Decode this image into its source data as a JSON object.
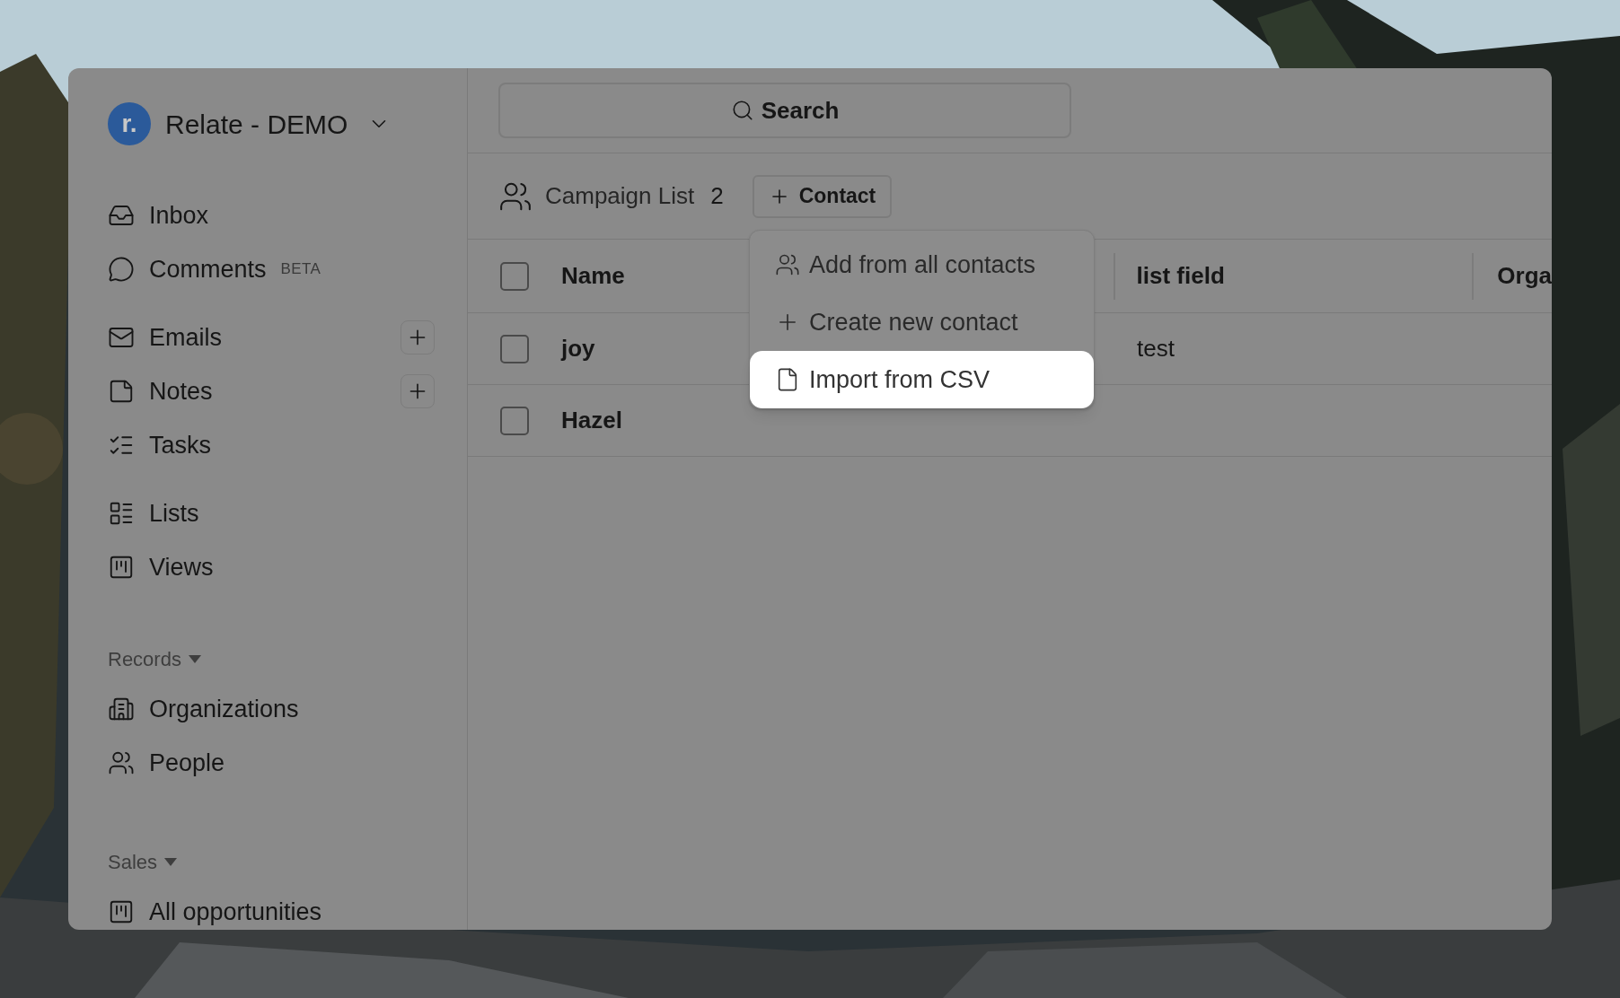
{
  "workspace": {
    "avatar": "r.",
    "name": "Relate - DEMO"
  },
  "sidebar": {
    "sections": [
      {
        "items": [
          {
            "label": "Inbox"
          },
          {
            "label": "Comments",
            "badge": "BETA"
          }
        ]
      },
      {
        "items": [
          {
            "label": "Emails",
            "add": true
          },
          {
            "label": "Notes",
            "add": true
          },
          {
            "label": "Tasks"
          }
        ]
      },
      {
        "items": [
          {
            "label": "Lists"
          },
          {
            "label": "Views"
          }
        ]
      },
      {
        "heading": "Records",
        "items": [
          {
            "label": "Organizations"
          },
          {
            "label": "People"
          }
        ]
      },
      {
        "heading": "Sales",
        "items": [
          {
            "label": "All opportunities"
          }
        ]
      }
    ]
  },
  "search": {
    "label": "Search"
  },
  "list_header": {
    "title": "Campaign List",
    "count": "2",
    "add_button": "Contact"
  },
  "menu": {
    "items": [
      {
        "label": "Add from all contacts",
        "selected": false
      },
      {
        "label": "Create new contact",
        "selected": false
      },
      {
        "label": "Import from CSV",
        "selected": true
      }
    ]
  },
  "table": {
    "header_checked": false,
    "columns": [
      "Name",
      "list field",
      "Orga"
    ],
    "rows": [
      {
        "checked": false,
        "name": "joy",
        "list_field": "test"
      },
      {
        "checked": false,
        "name": "Hazel"
      }
    ]
  }
}
